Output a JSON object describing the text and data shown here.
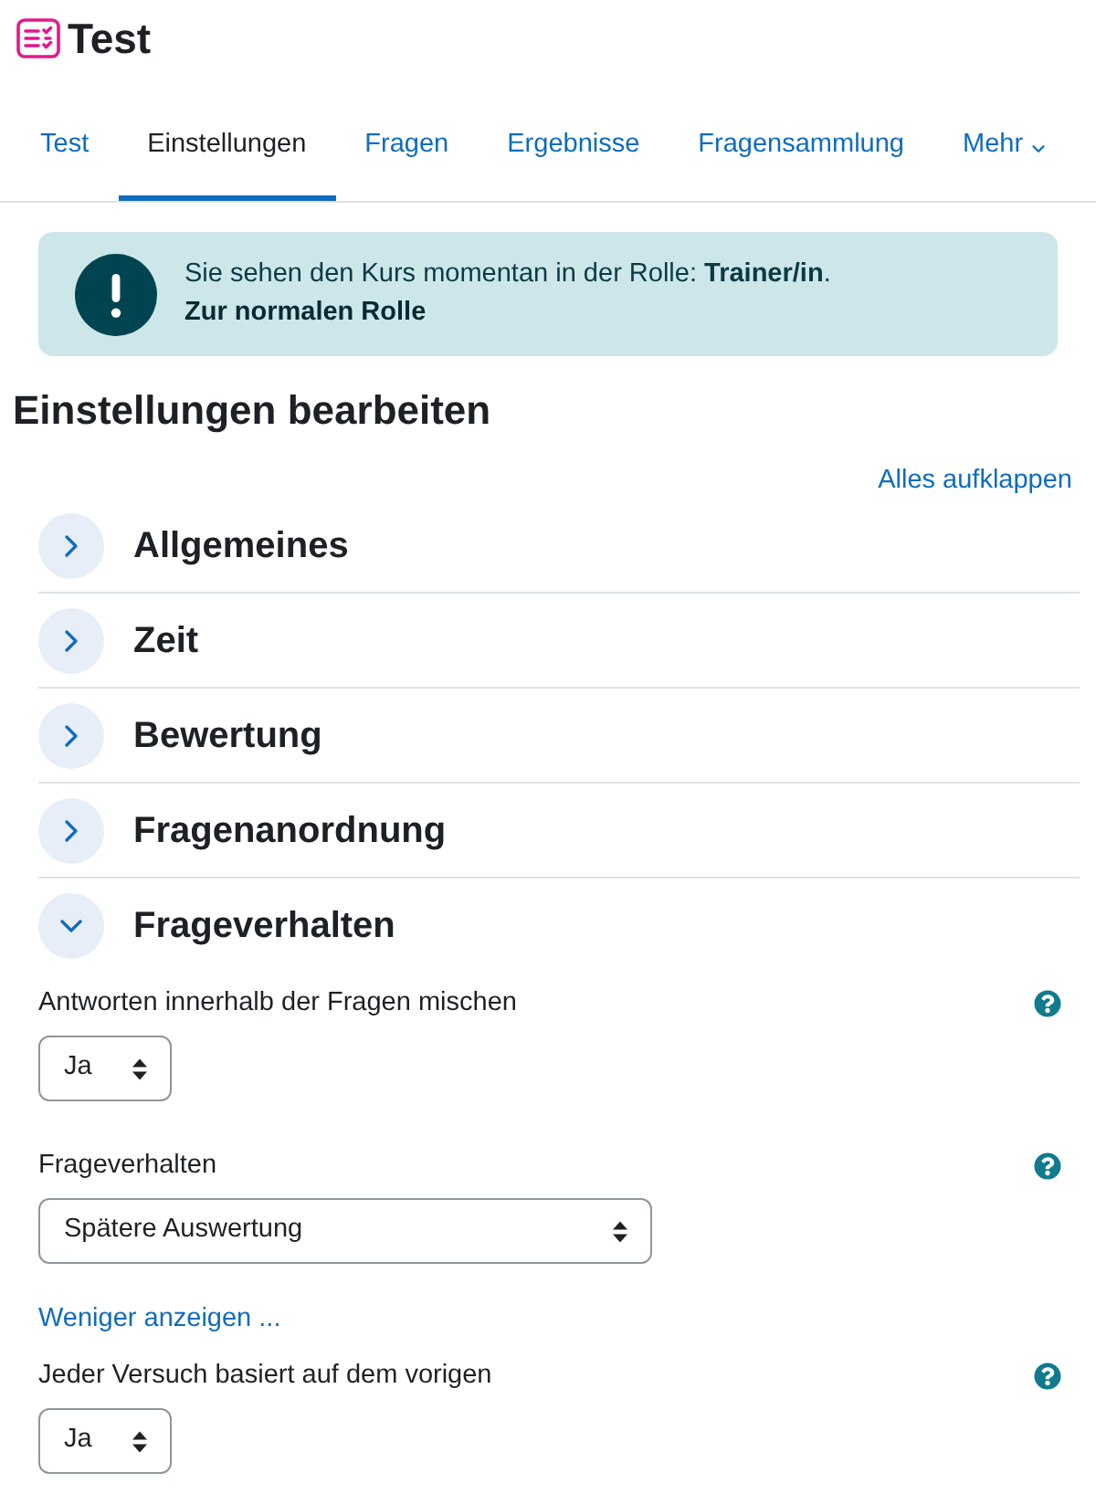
{
  "header": {
    "title": "Test"
  },
  "tabs": [
    {
      "label": "Test",
      "selected": false
    },
    {
      "label": "Einstellungen",
      "selected": true
    },
    {
      "label": "Fragen",
      "selected": false
    },
    {
      "label": "Ergebnisse",
      "selected": false
    },
    {
      "label": "Fragensammlung",
      "selected": false
    },
    {
      "label": "Mehr",
      "selected": false,
      "kind": "dropdown"
    }
  ],
  "alert": {
    "message": "Sie sehen den Kurs momentan in der Rolle: **Trainer/in**.",
    "link": "Zur normalen Rolle"
  },
  "page_heading": "Einstellungen bearbeiten",
  "expand_all_link": "Alles aufklappen",
  "sections": [
    {
      "title": "Allgemeines",
      "expanded": false
    },
    {
      "title": "Zeit",
      "expanded": false
    },
    {
      "title": "Bewertung",
      "expanded": false
    },
    {
      "title": "Fragenanordnung",
      "expanded": false
    },
    {
      "title": "Frageverhalten",
      "expanded": true,
      "fields": [
        {
          "kind": "select",
          "label": "Antworten innerhalb der Fragen mischen",
          "value": "Ja"
        },
        {
          "kind": "wide_select",
          "label": "Frageverhalten",
          "value": "Spätere Auswertung"
        },
        {
          "kind": "link",
          "label": "Weniger anzeigen ..."
        },
        {
          "kind": "select",
          "label": "Jeder Versuch basiert auf dem vorigen",
          "value": "Ja"
        }
      ]
    }
  ]
}
